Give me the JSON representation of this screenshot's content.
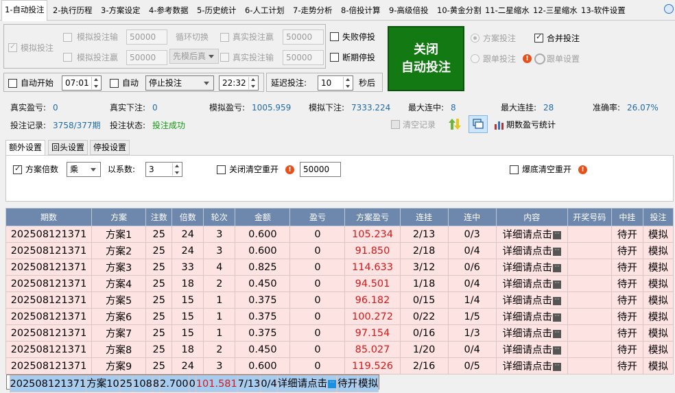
{
  "tabs": [
    "1-自动投注",
    "2-执行历程",
    "3-方案设定",
    "4-参考数据",
    "5-历史统计",
    "6-人工计划",
    "7-走势分析",
    "8-倍投计算",
    "9-高级倍投",
    "10-黄金分割",
    "11-二星缩水",
    "12-三星缩水",
    "13-软件设置"
  ],
  "sim": {
    "sim_bet": "模拟投注",
    "sim_loss": "模拟投注输",
    "sim_loss_val": "50000",
    "loop_switch": "循环切换",
    "real_win": "真实投注赢",
    "real_win_val": "50000",
    "sim_win": "模拟投注赢",
    "sim_win_val": "50000",
    "order": "先模后真",
    "real_loss": "真实投注输",
    "real_loss_val": "50000",
    "fail_stop": "失败停投",
    "break_stop": "断期停投"
  },
  "big_button": {
    "line1": "关闭",
    "line2": "自动投注"
  },
  "right": {
    "plan_bet": "方案投注",
    "merge_bet": "合并投注",
    "follow_bet": "跟单投注",
    "follow_setting": "跟单设置"
  },
  "schedule": {
    "auto_start": "自动开始",
    "start_time": "07:01",
    "auto": "自动",
    "action": "停止投注",
    "end_time": "22:32",
    "delay_label": "延迟投注:",
    "delay_val": "10",
    "delay_unit": "秒后"
  },
  "stats": {
    "real_pl_k": "真实盈亏:",
    "real_pl_v": "0",
    "real_bet_k": "真实下注:",
    "real_bet_v": "0",
    "sim_pl_k": "模拟盈亏:",
    "sim_pl_v": "1005.959",
    "sim_bet_k": "模拟下注:",
    "sim_bet_v": "7333.224",
    "max_win_k": "最大连中:",
    "max_win_v": "8",
    "max_loss_k": "最大连挂:",
    "max_loss_v": "28",
    "accuracy_k": "准确率:",
    "accuracy_v": "26.07%",
    "record_k": "投注记录:",
    "record_v": "3758/377期",
    "state_k": "投注状态:",
    "state_v": "投注成功",
    "clear": "清空记录",
    "period_stats": "期数盈亏统计"
  },
  "subtabs": [
    "额外设置",
    "回头设置",
    "停投设置"
  ],
  "extra": {
    "multiple": "方案倍数",
    "op": "乘",
    "coef_label": "以系数:",
    "coef_val": "3",
    "close_clear": "关闭清空重开",
    "close_clear_val": "50000",
    "burst_clear": "爆底清空重开"
  },
  "table": {
    "headers": [
      "期数",
      "方案",
      "注数",
      "倍数",
      "轮次",
      "金额",
      "盈亏",
      "方案盈亏",
      "连挂",
      "连中",
      "内容",
      "开奖号码",
      "中挂",
      "投注"
    ],
    "rows": [
      [
        "202508121371",
        "方案1",
        "25",
        "24",
        "3",
        "0.600",
        "0",
        "105.234",
        "2/13",
        "0/3",
        "详细请点击",
        "",
        "待开",
        "模拟"
      ],
      [
        "202508121371",
        "方案2",
        "25",
        "24",
        "3",
        "0.600",
        "0",
        "91.850",
        "2/18",
        "0/4",
        "详细请点击",
        "",
        "待开",
        "模拟"
      ],
      [
        "202508121371",
        "方案3",
        "25",
        "33",
        "4",
        "0.825",
        "0",
        "114.633",
        "3/12",
        "0/6",
        "详细请点击",
        "",
        "待开",
        "模拟"
      ],
      [
        "202508121371",
        "方案4",
        "25",
        "18",
        "2",
        "0.450",
        "0",
        "94.501",
        "1/18",
        "0/4",
        "详细请点击",
        "",
        "待开",
        "模拟"
      ],
      [
        "202508121371",
        "方案5",
        "25",
        "15",
        "1",
        "0.375",
        "0",
        "96.182",
        "0/15",
        "1/4",
        "详细请点击",
        "",
        "待开",
        "模拟"
      ],
      [
        "202508121371",
        "方案6",
        "25",
        "15",
        "1",
        "0.375",
        "0",
        "100.272",
        "0/22",
        "1/5",
        "详细请点击",
        "",
        "待开",
        "模拟"
      ],
      [
        "202508121371",
        "方案7",
        "25",
        "15",
        "1",
        "0.375",
        "0",
        "97.154",
        "0/16",
        "1/3",
        "详细请点击",
        "",
        "待开",
        "模拟"
      ],
      [
        "202508121371",
        "方案8",
        "25",
        "18",
        "2",
        "0.450",
        "0",
        "85.027",
        "1/20",
        "0/4",
        "详细请点击",
        "",
        "待开",
        "模拟"
      ],
      [
        "202508121371",
        "方案9",
        "25",
        "24",
        "3",
        "0.600",
        "0",
        "119.526",
        "2/16",
        "0/5",
        "详细请点击",
        "",
        "待开",
        "模拟"
      ],
      [
        "202508121371",
        "方案10",
        "25",
        "108",
        "8",
        "2.700",
        "0",
        "101.581",
        "7/13",
        "0/4",
        "详细请点击",
        "",
        "待开",
        "模拟"
      ]
    ],
    "selected_row": 9
  }
}
